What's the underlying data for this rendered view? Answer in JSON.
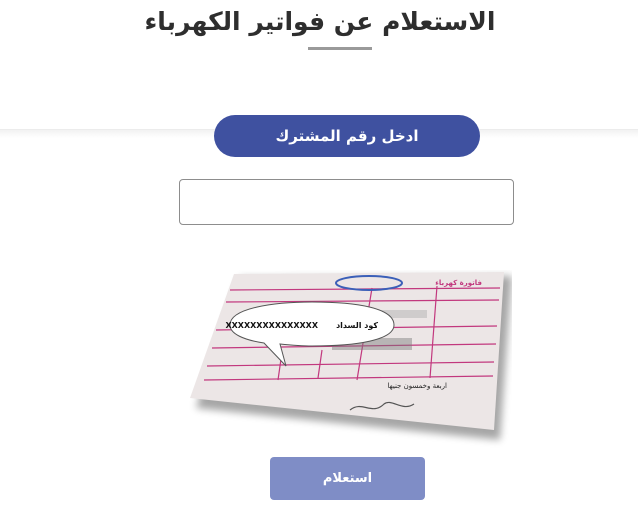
{
  "page": {
    "title": "الاستعلام عن فواتير الكهرباء"
  },
  "form": {
    "subscriber_label": "ادخل رقم المشترك",
    "subscriber_value": "",
    "submit_label": "استعلام"
  },
  "bill_image": {
    "header_title": "فاتورة كهرباء",
    "callout_code": "XXXXXXXXXXXXXXX",
    "callout_label": "كود السداد",
    "words_line": "اربعة وخمسون جنيها"
  },
  "colors": {
    "accent": "#3f51a0",
    "button": "#7f8dc6",
    "bill_ink": "#c2387e"
  }
}
